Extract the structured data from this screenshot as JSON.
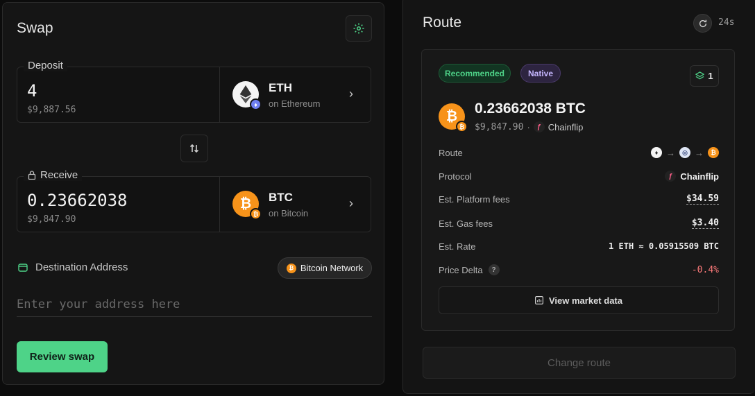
{
  "swap": {
    "title": "Swap",
    "deposit": {
      "legend": "Deposit",
      "amount": "4",
      "usd": "$9,887.56",
      "symbol": "ETH",
      "chain": "on Ethereum"
    },
    "receive": {
      "legend": "Receive",
      "amount": "0.23662038",
      "usd": "$9,847.90",
      "symbol": "BTC",
      "chain": "on Bitcoin"
    },
    "destination_label": "Destination Address",
    "network_pill": "Bitcoin Network",
    "address_placeholder": "Enter your address here",
    "review_label": "Review swap"
  },
  "route": {
    "title": "Route",
    "timer": "24s",
    "badges": {
      "recommended": "Recommended",
      "native": "Native",
      "steps": "1"
    },
    "output_amount": "0.23662038 BTC",
    "output_usd": "$9,847.90",
    "output_sep": "·",
    "output_provider": "Chainflip",
    "rows": {
      "route_label": "Route",
      "protocol_label": "Protocol",
      "protocol_value": "Chainflip",
      "platform_fees_label": "Est. Platform fees",
      "platform_fees_value": "$34.59",
      "gas_fees_label": "Est. Gas fees",
      "gas_fees_value": "$3.40",
      "rate_label": "Est. Rate",
      "rate_value": "1 ETH ≈ 0.05915509 BTC",
      "delta_label": "Price Delta",
      "delta_help": "?",
      "delta_value": "-0.4%"
    },
    "view_market_label": "View market data",
    "change_route_label": "Change route"
  },
  "colors": {
    "accent_green": "#4ed388",
    "btc_orange": "#f7931a",
    "negative": "#ff7b7b",
    "native_purple": "#c4b5fd"
  }
}
